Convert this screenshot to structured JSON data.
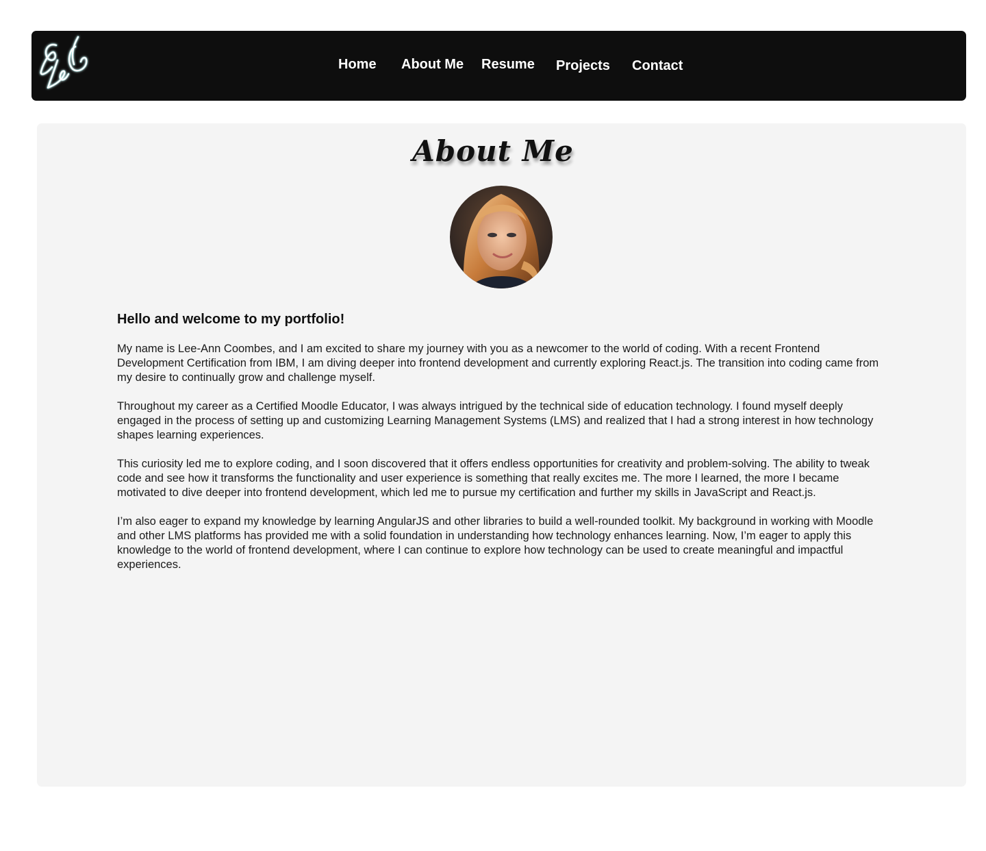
{
  "nav": {
    "logo_icon": "signature-logo-icon",
    "logo_text": "LAC",
    "links": [
      "Home",
      "About Me",
      "Resume",
      "Projects",
      "Contact"
    ]
  },
  "main": {
    "title": "About Me",
    "avatar_icon": "profile-photo",
    "greeting": "Hello and welcome to my portfolio!",
    "paragraphs": [
      "My name is Lee-Ann Coombes, and I am excited to share my journey with you as a newcomer to the world of coding. With a recent Frontend Development Certification from IBM, I am diving deeper into frontend development and currently exploring React.js. The transition into coding came from my desire to continually grow and challenge myself.",
      "Throughout my career as a Certified Moodle Educator, I was always intrigued by the technical side of education technology. I found myself deeply engaged in the process of setting up and customizing Learning Management Systems (LMS) and realized that I had a strong interest in how technology shapes learning experiences.",
      "This curiosity led me to explore coding, and I soon discovered that it offers endless opportunities for creativity and problem-solving. The ability to tweak code and see how it transforms the functionality and user experience is something that really excites me. The more I learned, the more I became motivated to dive deeper into frontend development, which led me to pursue my certification and further my skills in JavaScript and React.js.",
      "I’m also eager to expand my knowledge by learning AngularJS and other libraries to build a well-rounded toolkit. My background in working with Moodle and other LMS platforms has provided me with a solid foundation in understanding how technology enhances learning. Now, I’m eager to apply this knowledge to the world of frontend development, where I can continue to explore how technology can be used to create meaningful and impactful experiences."
    ]
  },
  "colors": {
    "nav_bg": "#0e0e0e",
    "content_bg": "#f4f4f4",
    "logo_glow": "#7ee8ea"
  }
}
